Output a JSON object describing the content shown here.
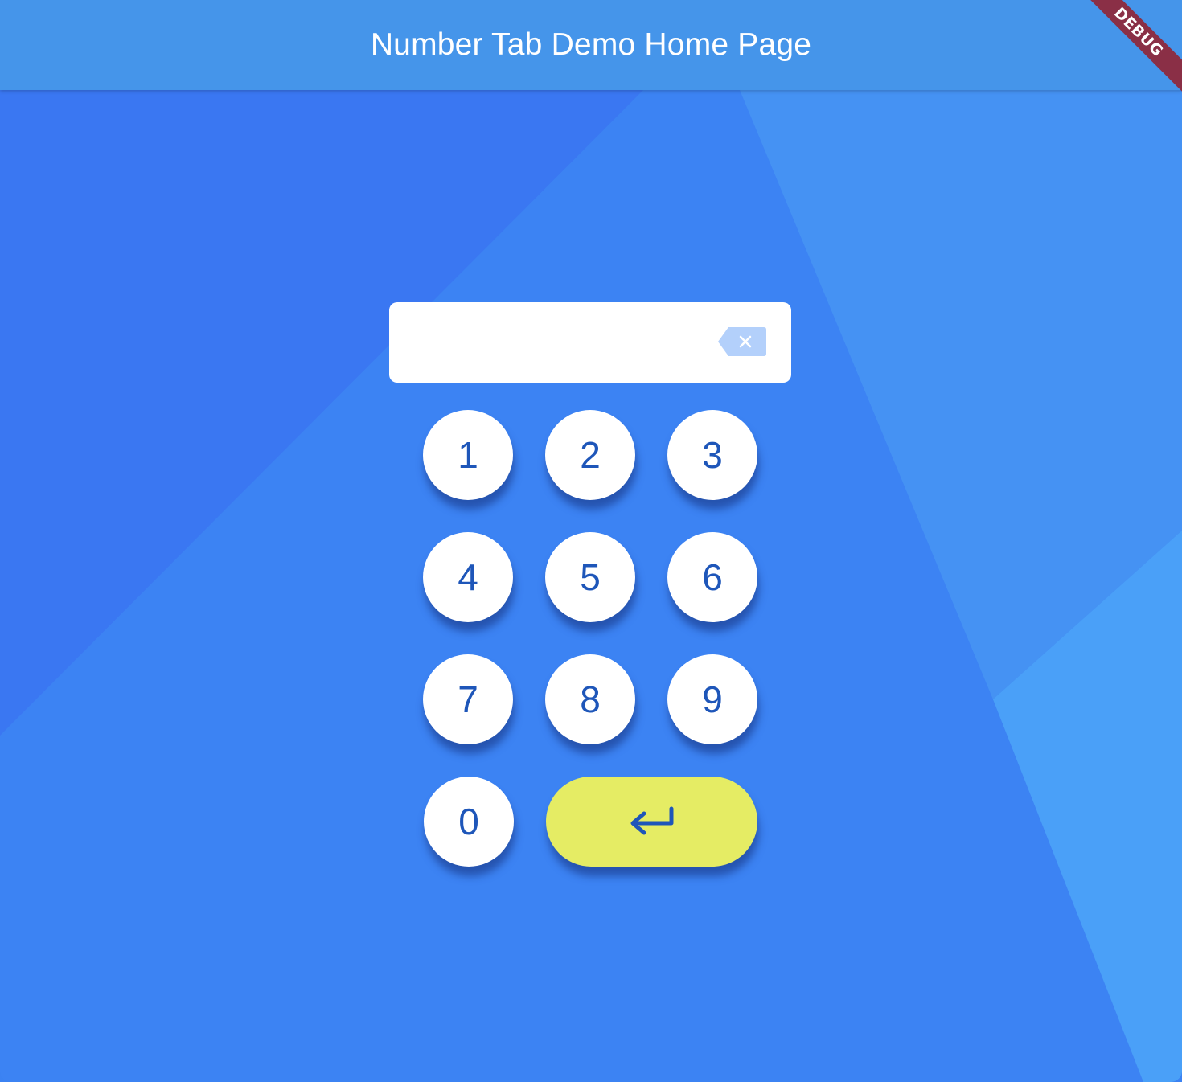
{
  "appbar": {
    "title": "Number Tab Demo Home Page"
  },
  "debug_banner": {
    "label": "DEBUG"
  },
  "display": {
    "value": ""
  },
  "keypad": {
    "keys": [
      "1",
      "2",
      "3",
      "4",
      "5",
      "6",
      "7",
      "8",
      "9",
      "0"
    ],
    "clear_icon": "backspace-icon",
    "enter_icon": "enter-arrow-icon"
  },
  "colors": {
    "appbar": "#4595ea",
    "background": "#3c83f3",
    "key_text": "#1e56b9",
    "enter_key": "#e5ec64",
    "debug_banner": "#8a2f46"
  }
}
